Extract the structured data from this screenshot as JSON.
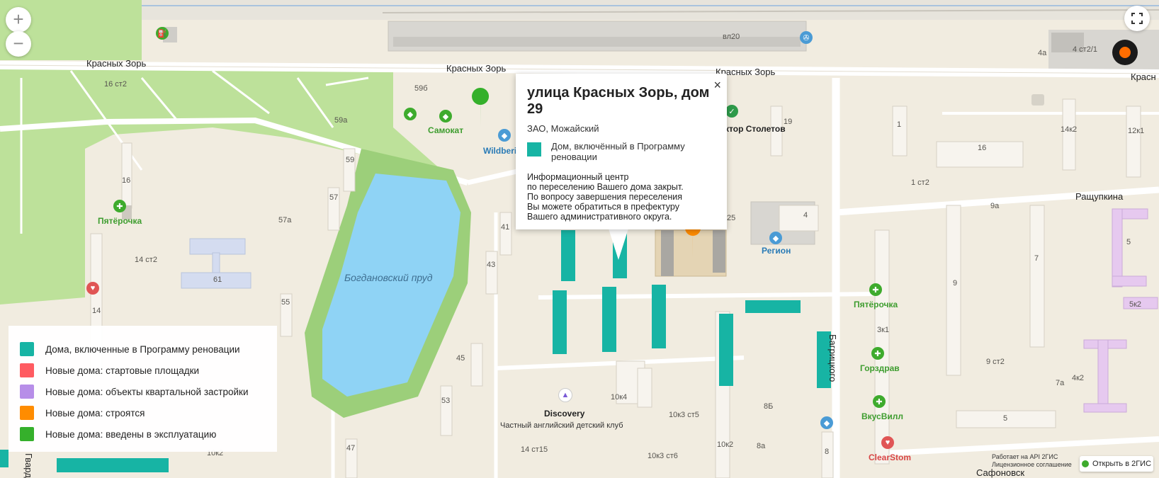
{
  "map": {
    "streets": [
      "Красных Зорь",
      "Красных Зорь",
      "Красных Зорь",
      "Красн",
      "Ращупкина",
      "Багрицкого",
      "Сафоновск",
      "Гвард"
    ],
    "water_label": "Богдановский пруд",
    "house_numbers": [
      "16 ст2",
      "59б",
      "59а",
      "59",
      "57",
      "57а",
      "16",
      "14 ст2",
      "61",
      "55",
      "14",
      "41",
      "43",
      "45",
      "53",
      "47",
      "10к2",
      "вл20",
      "4 ст2/1",
      "4а",
      "19",
      "1",
      "16",
      "14к2",
      "12к1",
      "1 ст2",
      "9а",
      "4",
      "25",
      "5",
      "7",
      "9",
      "3к1",
      "9 ст2",
      "7а",
      "4к2",
      "5к2",
      "5",
      "10к4",
      "10к3 ст5",
      "8Б",
      "10к2",
      "8а",
      "10к3 ст6",
      "14 ст15",
      "8"
    ],
    "pois": {
      "samokat": "Самокат",
      "wildberries": "Wildberi",
      "doktor": "Доктор Столетов",
      "pyaterochka_left": "Пятёрочка",
      "pyaterochka_right": "Пятёрочка",
      "region": "Регион",
      "gorzdrav": "Горздрав",
      "vkusvill": "ВкусВилл",
      "clearstom": "ClearStom",
      "discovery": "Discovery",
      "club": "Частный английский детский клуб"
    }
  },
  "controls": {
    "zoom_in": "+",
    "zoom_out": "−"
  },
  "popup": {
    "title": "улица Красных Зорь, дом 29",
    "district": "ЗАО, Можайский",
    "category": "Дом, включённый в Программу реновации",
    "info_lines": [
      "Информационный центр",
      "по переселению Вашего дома закрыт.",
      "По вопросу завершения переселения",
      "Вы можете обратиться в префектуру",
      "Вашего административного округа."
    ],
    "close": "×"
  },
  "legend": {
    "items": [
      {
        "label": "Дома, включенные в Программу реновации",
        "color": "#17b4a4"
      },
      {
        "label": "Новые дома: стартовые площадки",
        "color": "#ff5b61"
      },
      {
        "label": "Новые дома: объекты квартальной застройки",
        "color": "#b78ee8"
      },
      {
        "label": "Новые дома: строятся",
        "color": "#ff8c00"
      },
      {
        "label": "Новые дома: введены в эксплуатацию",
        "color": "#35b02b"
      }
    ]
  },
  "attribution": {
    "line1": "Работает на API 2ГИС",
    "line2": "Лицензионное соглашение"
  },
  "open_2gis": "Открыть в 2ГИС",
  "colors": {
    "park": "#bde19a",
    "water": "#8fd3f5",
    "water_edge": "#9ccf7a",
    "renovation": "#17b4a4",
    "road": "#ffffff",
    "ground": "#f1ece0"
  }
}
